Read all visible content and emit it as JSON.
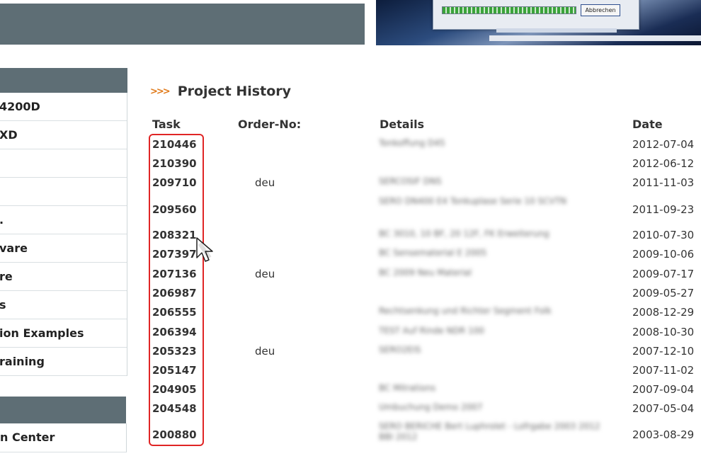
{
  "sidebar": {
    "items": [
      {
        "label": "4200D"
      },
      {
        "label": "XD"
      },
      {
        "label": ""
      },
      {
        "label": ""
      },
      {
        "label": "."
      },
      {
        "label": "vare"
      },
      {
        "label": "re"
      },
      {
        "label": "s"
      },
      {
        "label": "ion Examples"
      },
      {
        "label": "raining"
      }
    ],
    "center_item": {
      "label": "n Center"
    }
  },
  "hero": {
    "button_label": "Abbrechen"
  },
  "section": {
    "title": "Project History",
    "arrows": ">>>"
  },
  "table": {
    "headers": {
      "task": "Task",
      "order": "Order-No:",
      "details": "Details",
      "date": "Date"
    },
    "rows": [
      {
        "task": "210446",
        "order": "",
        "details": "Tonkoffung D45",
        "date": "2012-07-04"
      },
      {
        "task": "210390",
        "order": "",
        "details": "",
        "date": "2012-06-12"
      },
      {
        "task": "209710",
        "order": "deu",
        "details": "SERCOSIF DNS",
        "date": "2011-11-03"
      },
      {
        "task": "209560",
        "order": "",
        "details": "SERO DN400 E4 Tonkuplase Serie 10 SCVTN",
        "date": "2011-09-23"
      },
      {
        "task": "208321",
        "order": "",
        "details": "BC 3010, 10 BF, 20 12F, FK Erweiterung",
        "date": "2010-07-30"
      },
      {
        "task": "207397",
        "order": "",
        "details": "BC Sensematerial E 2005",
        "date": "2009-10-06"
      },
      {
        "task": "207136",
        "order": "deu",
        "details": "BC 2009 Neu Material",
        "date": "2009-07-17"
      },
      {
        "task": "206987",
        "order": "",
        "details": "",
        "date": "2009-05-27"
      },
      {
        "task": "206555",
        "order": "",
        "details": "Rechtsenkung und Richter Segment Folk",
        "date": "2008-12-29"
      },
      {
        "task": "206394",
        "order": "",
        "details": "TEST Auf Rinde NDR 100",
        "date": "2008-10-30"
      },
      {
        "task": "205323",
        "order": "deu",
        "details": "SERO2EIS",
        "date": "2007-12-10"
      },
      {
        "task": "205147",
        "order": "",
        "details": "",
        "date": "2007-11-02"
      },
      {
        "task": "204905",
        "order": "",
        "details": "BC Mitrations",
        "date": "2007-09-04"
      },
      {
        "task": "204548",
        "order": "",
        "details": "Umbuchung Demo 2007",
        "date": "2007-05-04"
      },
      {
        "task": "200880",
        "order": "",
        "details": "SERO BERICHE Bert Luphrolet - Lofrgabe 2003 2012 BBI 2012",
        "date": "2003-08-29"
      }
    ]
  },
  "colors": {
    "header_band": "#5e6e75",
    "highlight": "#e02525",
    "arrow_accent": "#e07a1a"
  },
  "icons": {
    "cursor": "mouse-pointer-icon",
    "section_marker": "double-chevron-icon"
  }
}
